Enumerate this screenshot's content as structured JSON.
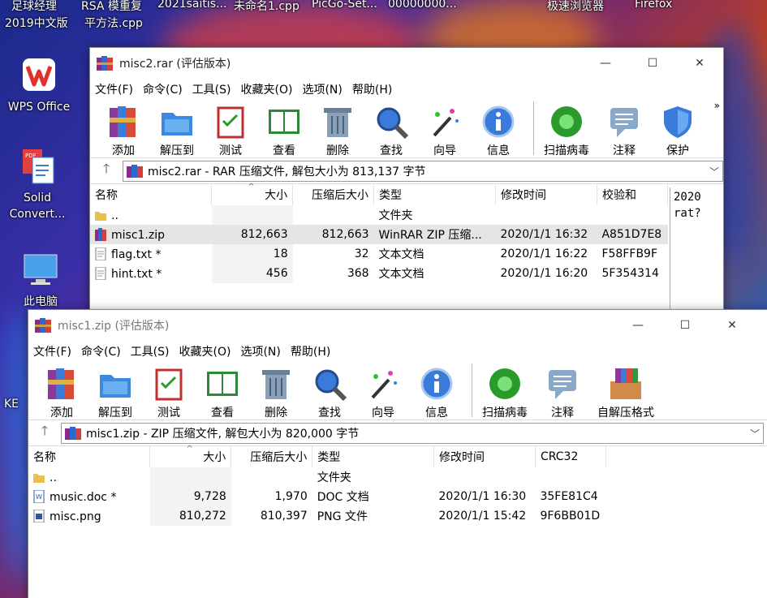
{
  "desktop": {
    "top_labels": [
      "足球经理",
      "RSA 模重复",
      "2021saitis...",
      "未命名1.cpp",
      "PicGo-Set...",
      "00000000...",
      "极速浏览器",
      "Firefox",
      "2019中文版",
      "平方法.cpp"
    ],
    "icons": [
      {
        "label": "WPS Office",
        "icon": "wps-office-icon"
      },
      {
        "label": "Solid\nConvert...",
        "icon": "pdf-converter-icon"
      },
      {
        "label": "此电脑",
        "icon": "computer-icon"
      },
      {
        "label": "KE",
        "icon": "app-icon"
      }
    ]
  },
  "win1": {
    "title": "misc2.rar (评估版本)",
    "menus": [
      "文件(F)",
      "命令(C)",
      "工具(S)",
      "收藏夹(O)",
      "选项(N)",
      "帮助(H)"
    ],
    "tools": [
      "添加",
      "解压到",
      "测试",
      "查看",
      "删除",
      "查找",
      "向导",
      "信息",
      "扫描病毒",
      "注释",
      "保护"
    ],
    "address": "misc2.rar - RAR 压缩文件, 解包大小为 813,137 字节",
    "columns": [
      "名称",
      "大小",
      "压缩后大小",
      "类型",
      "修改时间",
      "校验和"
    ],
    "rows": [
      {
        "name": "..",
        "size": "",
        "packed": "",
        "type": "文件夹",
        "modified": "",
        "checksum": ""
      },
      {
        "name": "misc1.zip",
        "size": "812,663",
        "packed": "812,663",
        "type": "WinRAR ZIP 压缩...",
        "modified": "2020/1/1 16:32",
        "checksum": "A851D7E8"
      },
      {
        "name": "flag.txt *",
        "size": "18",
        "packed": "32",
        "type": "文本文档",
        "modified": "2020/1/1 16:22",
        "checksum": "F58FFB9F"
      },
      {
        "name": "hint.txt *",
        "size": "456",
        "packed": "368",
        "type": "文本文档",
        "modified": "2020/1/1 16:20",
        "checksum": "5F354314"
      }
    ],
    "comment": [
      "2020",
      "rat?"
    ]
  },
  "win2": {
    "title": "misc1.zip (评估版本)",
    "menus": [
      "文件(F)",
      "命令(C)",
      "工具(S)",
      "收藏夹(O)",
      "选项(N)",
      "帮助(H)"
    ],
    "tools": [
      "添加",
      "解压到",
      "测试",
      "查看",
      "删除",
      "查找",
      "向导",
      "信息",
      "扫描病毒",
      "注释",
      "自解压格式"
    ],
    "address": "misc1.zip - ZIP 压缩文件, 解包大小为 820,000 字节",
    "columns": [
      "名称",
      "大小",
      "压缩后大小",
      "类型",
      "修改时间",
      "CRC32"
    ],
    "rows": [
      {
        "name": "..",
        "size": "",
        "packed": "",
        "type": "文件夹",
        "modified": "",
        "checksum": ""
      },
      {
        "name": "music.doc *",
        "size": "9,728",
        "packed": "1,970",
        "type": "DOC 文档",
        "modified": "2020/1/1 16:30",
        "checksum": "35FE81C4"
      },
      {
        "name": "misc.png",
        "size": "810,272",
        "packed": "810,397",
        "type": "PNG 文件",
        "modified": "2020/1/1 15:42",
        "checksum": "9F6BB01D"
      }
    ]
  }
}
